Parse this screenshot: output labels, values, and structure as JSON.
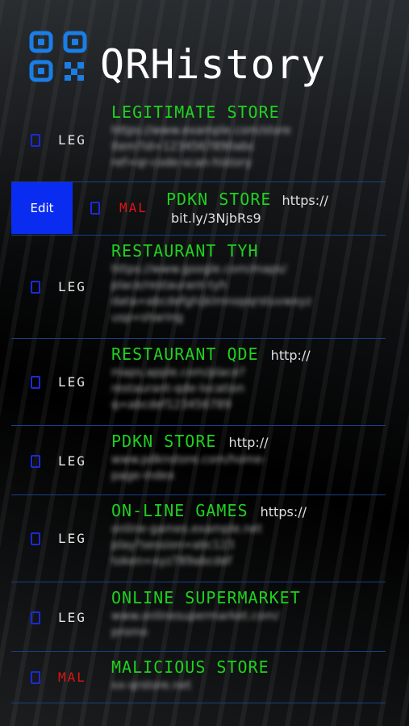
{
  "app": {
    "title": "QRHistory"
  },
  "edit_label": "Edit",
  "colors": {
    "legit": "#1fd21f",
    "malicious_tag": "#e01414",
    "edit_bg": "#0a2cf0",
    "divider": "#1c3f8a"
  },
  "items": [
    {
      "tag": "LEG",
      "name": "LEGITIMATE STORE",
      "url": ""
    },
    {
      "tag": "MAL",
      "name": "PDKN STORE",
      "url_part1": "https://",
      "url_part2": "bit.ly/3NjbRs9"
    },
    {
      "tag": "LEG",
      "name": "RESTAURANT TYH",
      "url": ""
    },
    {
      "tag": "LEG",
      "name": "RESTAURANT QDE",
      "url": "http://"
    },
    {
      "tag": "LEG",
      "name": "PDKN STORE",
      "url": "http://"
    },
    {
      "tag": "LEG",
      "name": "ON-LINE GAMES",
      "url": "https://"
    },
    {
      "tag": "LEG",
      "name": "ONLINE SUPERMARKET",
      "url": ""
    },
    {
      "tag": "MAL",
      "name": "MALICIOUS STORE",
      "url": ""
    }
  ]
}
